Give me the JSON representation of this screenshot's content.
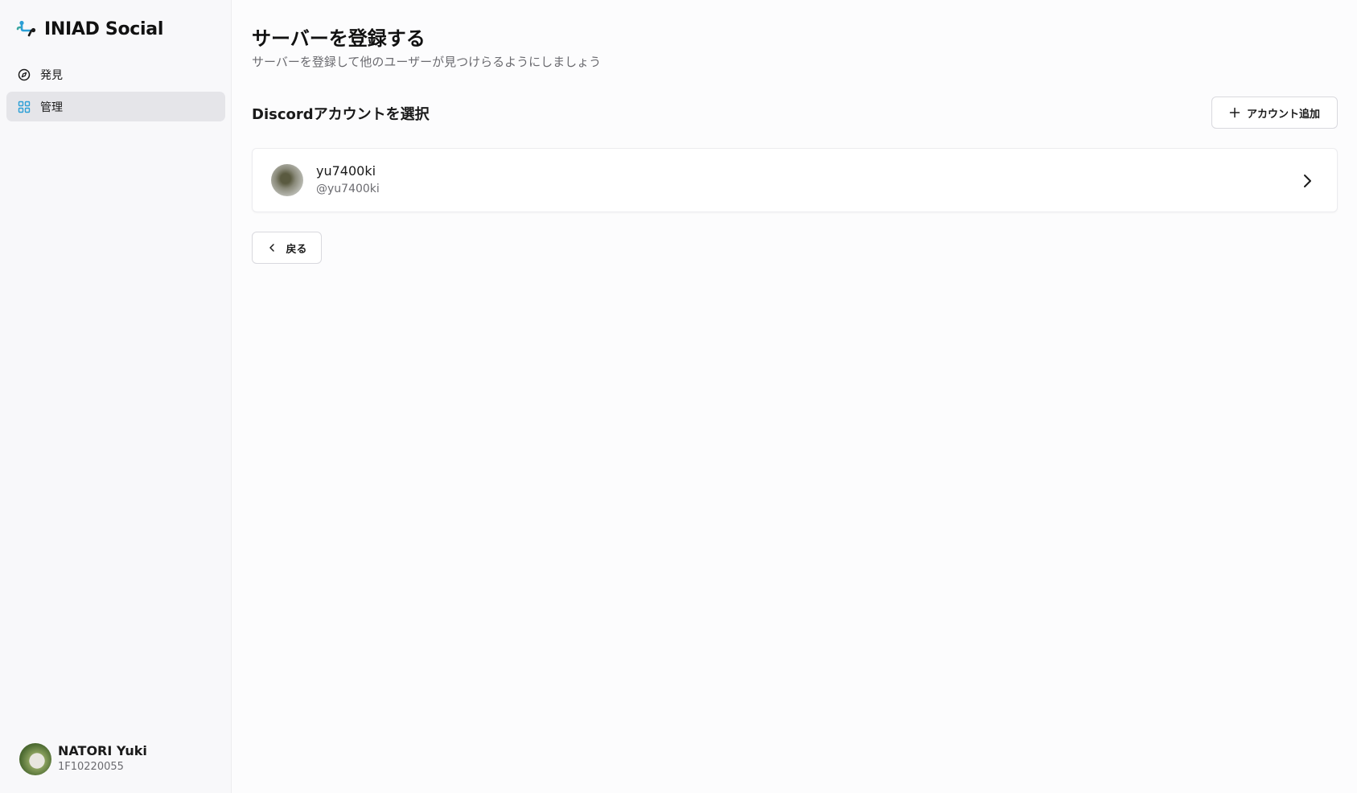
{
  "app": {
    "name": "INIAD Social",
    "accent_blue": "#2b9fd6",
    "accent_teal": "#3aa7a0"
  },
  "sidebar": {
    "items": [
      {
        "label": "発見",
        "icon": "compass-icon",
        "active": false
      },
      {
        "label": "管理",
        "icon": "grid-icon",
        "active": true
      }
    ]
  },
  "user": {
    "name": "NATORI Yuki",
    "id": "1F10220055"
  },
  "main": {
    "title": "サーバーを登録する",
    "subtitle": "サーバーを登録して他のユーザーが見つけらるようにしましょう",
    "section_title": "Discordアカウントを選択",
    "add_account_label": "アカウント追加",
    "accounts": [
      {
        "name": "yu7400ki",
        "handle": "@yu7400ki"
      }
    ],
    "back_label": "戻る"
  }
}
